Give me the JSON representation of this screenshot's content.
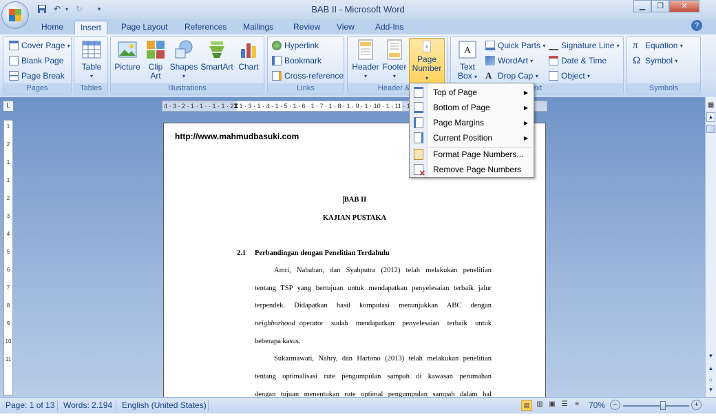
{
  "titlebar": {
    "title": "BAB II - Microsoft Word",
    "qat_icons": [
      "save-icon",
      "undo-icon",
      "redo-icon",
      "customize-icon"
    ],
    "window_controls": [
      "minimize-icon",
      "restore-icon",
      "close-icon"
    ]
  },
  "tabs": [
    "Home",
    "Insert",
    "Page Layout",
    "References",
    "Mailings",
    "Review",
    "View",
    "Add-Ins"
  ],
  "active_tab": "Insert",
  "ribbon": {
    "pages": {
      "label": "Pages",
      "items": [
        "Cover Page",
        "Blank Page",
        "Page Break"
      ]
    },
    "tables": {
      "label": "Tables",
      "item": "Table"
    },
    "illustrations": {
      "label": "Illustrations",
      "items": [
        "Picture",
        "Clip Art",
        "Shapes",
        "SmartArt",
        "Chart"
      ]
    },
    "links": {
      "label": "Links",
      "items": [
        "Hyperlink",
        "Bookmark",
        "Cross-reference"
      ]
    },
    "header_footer": {
      "label": "Header & F",
      "items": [
        "Header",
        "Footer",
        "Page Number"
      ]
    },
    "text": {
      "label": "ext",
      "items": [
        "Text Box",
        "Quick Parts",
        "WordArt",
        "Drop Cap",
        "Signature Line",
        "Date & Time",
        "Object"
      ]
    },
    "symbols": {
      "label": "Symbols",
      "items": [
        "Equation",
        "Symbol"
      ]
    }
  },
  "dropdown": {
    "items": [
      "Top of Page",
      "Bottom of Page",
      "Page Margins",
      "Current Position",
      "Format Page Numbers...",
      "Remove Page Numbers"
    ]
  },
  "ruler": {
    "h_marks": "4 · 3 · 2 · 1 · 1 · · 1 · 1 · 2 · 1 · 3 · 1 · 4 · 1 · 5 · 1 · 6 · 1 · 7 · 1 · 8 · 1 · 9 · 1 · 10 · 1 · 11 · 1 · 12 · 1 · 13 · 1 · 14",
    "v_marks": [
      "1",
      "2",
      "1",
      "1",
      "2",
      "3",
      "4",
      "5",
      "6",
      "7",
      "8",
      "9",
      "10",
      "11"
    ]
  },
  "document": {
    "url": "http://www.mahmudbasuki.com",
    "heading1": "BAB II",
    "heading2": "KAJIAN PUSTAKA",
    "section_num": "2.1",
    "section_title": "Perbandingan dengan Penelitian Terdahulu",
    "lines": [
      "Amri, Nababan, dan Syahputra (2012) telah melakukan penelitian",
      "tentang TSP yang bertujuan untuk mendapatkan penyelesaian terbaik jalur",
      "terpendek. Didapatkan hasil komputasi menunjukkan ABC dengan",
      "operator sudah mendapatkan penyelesaian terbaik untuk",
      "beberapa kasus.",
      "Sukarmawati, Nahry, dan Hartono (2013) telah melakukan penelitian",
      "tentang optimalisasi rute pengumpulan sampah di kawasan perumahan",
      "dengan tujuan menentukan rute optimal pengumpulan sampah dalam hal"
    ],
    "italic_word": "neighborhood"
  },
  "status": {
    "page": "Page: 1 of 13",
    "words": "Words: 2.194",
    "language": "English (United States)",
    "zoom": "70%",
    "zoom_fraction": 0.6
  }
}
